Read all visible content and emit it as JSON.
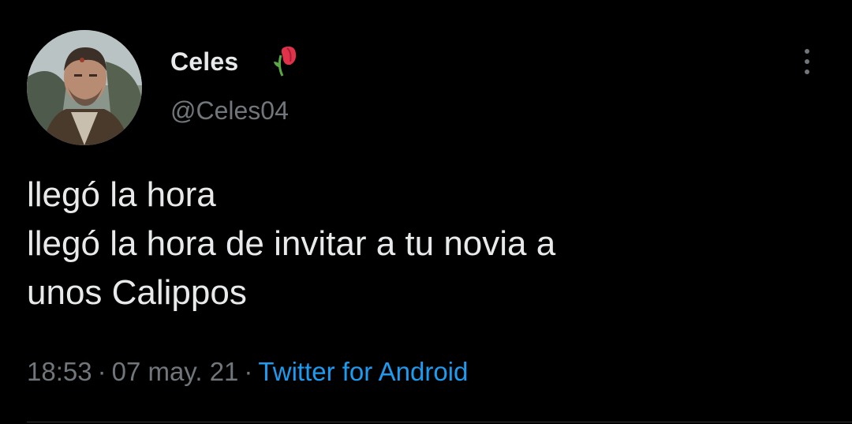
{
  "tweet": {
    "author": {
      "display_name": "Celes",
      "name_emoji": "wilted-rose-emoji",
      "handle": "@Celes04",
      "avatar": "user-avatar-photo"
    },
    "body_lines": [
      "llegó la hora",
      "llegó la hora de invitar a tu novia a",
      "unos Calippos"
    ],
    "meta": {
      "time": "18:53",
      "separator": "·",
      "date": "07 may. 21",
      "source": "Twitter for Android"
    },
    "more_icon": "more-options-vertical-icon"
  },
  "colors": {
    "background": "#000000",
    "text_primary": "#e7e9ea",
    "text_secondary": "#71767b",
    "link": "#1d9bf0"
  }
}
